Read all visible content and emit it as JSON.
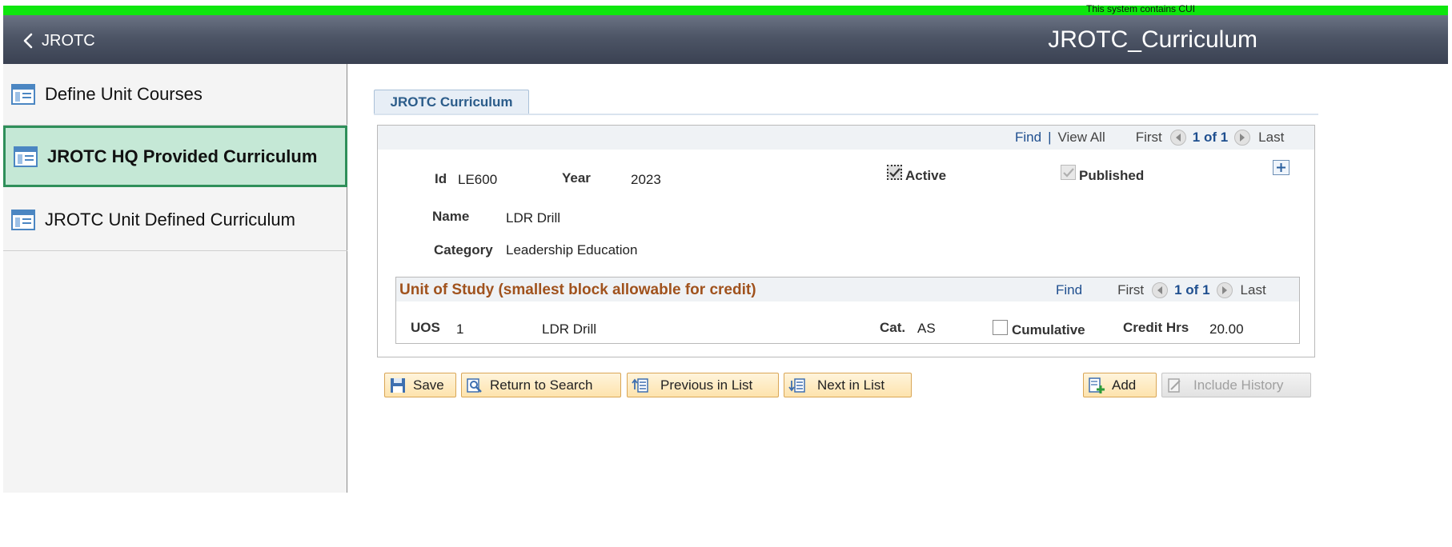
{
  "banner": {
    "text": "This system contains CUI"
  },
  "header": {
    "back_label": "JROTC",
    "title": "JROTC_Curriculum"
  },
  "sidebar": {
    "items": [
      {
        "label": "Define Unit Courses",
        "active": false
      },
      {
        "label": "JROTC HQ Provided Curriculum",
        "active": true
      },
      {
        "label": "JROTC Unit Defined Curriculum",
        "active": false
      }
    ]
  },
  "tab": {
    "label": "JROTC Curriculum"
  },
  "main_nav": {
    "find": "Find",
    "separator": "|",
    "view_all": "View All",
    "first": "First",
    "count": "1 of 1",
    "last": "Last"
  },
  "record": {
    "id_label": "Id",
    "id_value": "LE600",
    "year_label": "Year",
    "year_value": "2023",
    "active_label": "Active",
    "active_checked": true,
    "published_label": "Published",
    "published_checked": true,
    "name_label": "Name",
    "name_value": "LDR Drill",
    "category_label": "Category",
    "category_value": "Leadership Education"
  },
  "unit_of_study": {
    "title": "Unit of Study (smallest block allowable for credit)",
    "nav": {
      "find": "Find",
      "first": "First",
      "count": "1 of 1",
      "last": "Last"
    },
    "uos_label": "UOS",
    "uos_value": "1",
    "uos_name": "LDR Drill",
    "cat_label": "Cat.",
    "cat_value": "AS",
    "cumulative_label": "Cumulative",
    "cumulative_checked": false,
    "credit_label": "Credit Hrs",
    "credit_value": "20.00"
  },
  "buttons": {
    "save": "Save",
    "return_to_search": "Return to Search",
    "previous_in_list": "Previous in List",
    "next_in_list": "Next in List",
    "add": "Add",
    "include_history": "Include History"
  },
  "colors": {
    "banner": "#0ee60e",
    "header": "#4d5566",
    "active_item": "#c5e8d6",
    "section_title": "#a0521d",
    "link": "#1f4f8f"
  }
}
